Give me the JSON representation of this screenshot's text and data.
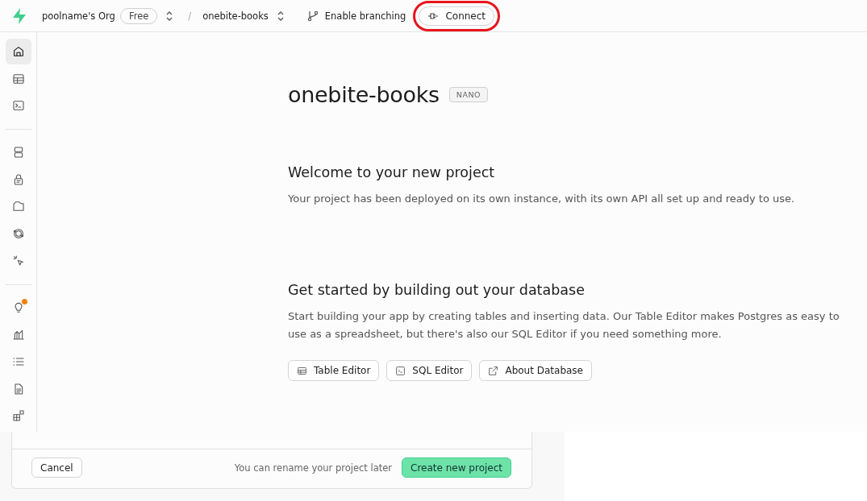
{
  "topbar": {
    "org": "poolname's Org",
    "plan": "Free",
    "separator": "/",
    "project": "onebite-books",
    "branch_button": "Enable branching",
    "connect_button": "Connect"
  },
  "sidebar": {
    "groups": [
      [
        {
          "selected": true,
          "badge": false
        },
        {
          "selected": false,
          "badge": false
        },
        {
          "selected": false,
          "badge": false
        }
      ],
      [
        {
          "selected": false,
          "badge": false
        },
        {
          "selected": false,
          "badge": false
        },
        {
          "selected": false,
          "badge": false
        },
        {
          "selected": false,
          "badge": false
        },
        {
          "selected": false,
          "badge": false
        }
      ],
      [
        {
          "selected": false,
          "badge": true
        },
        {
          "selected": false,
          "badge": false
        },
        {
          "selected": false,
          "badge": false
        },
        {
          "selected": false,
          "badge": false
        },
        {
          "selected": false,
          "badge": false
        }
      ]
    ]
  },
  "project": {
    "name": "onebite-books",
    "size_badge": "NANO"
  },
  "sections": [
    {
      "title": "Welcome to your new project",
      "text": "Your project has been deployed on its own instance, with its own API all set up and ready to use."
    },
    {
      "title": "Get started by building out your database",
      "text": "Start building your app by creating tables and inserting data. Our Table Editor makes Postgres as easy to use as a spreadsheet, but there's also our SQL Editor if you need something more.",
      "buttons": [
        "Table Editor",
        "SQL Editor",
        "About Database"
      ]
    }
  ],
  "background_dialog": {
    "cancel_button": "Cancel",
    "hint": "You can rename your project later",
    "create_button": "Create new project"
  }
}
